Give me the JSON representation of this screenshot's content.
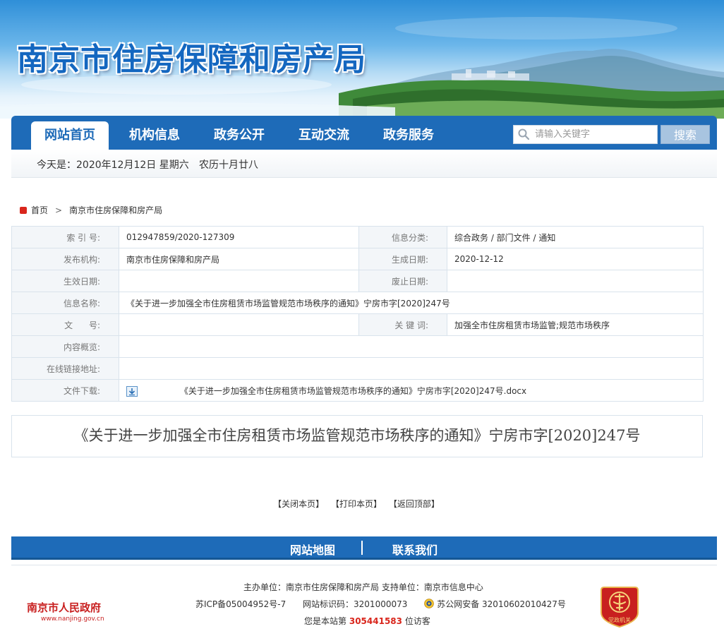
{
  "header": {
    "site_title": "南京市住房保障和房产局"
  },
  "nav": {
    "items": [
      {
        "label": "网站首页",
        "active": true
      },
      {
        "label": "机构信息",
        "active": false
      },
      {
        "label": "政务公开",
        "active": false
      },
      {
        "label": "互动交流",
        "active": false
      },
      {
        "label": "政务服务",
        "active": false
      }
    ],
    "search": {
      "placeholder": "请输入关键字",
      "button_label": "搜索"
    }
  },
  "datebar": {
    "today": "今天是：2020年12月12日  星期六",
    "lunar": "农历十月廿八"
  },
  "breadcrumb": {
    "home": "首页",
    "separator": ">",
    "current": "南京市住房保障和房产局"
  },
  "info": {
    "index_label": "索 引 号:",
    "index_value": "012947859/2020-127309",
    "category_label": "信息分类:",
    "category_value": "综合政务 / 部门文件 / 通知",
    "publisher_label": "发布机构:",
    "publisher_value": "南京市住房保障和房产局",
    "created_label": "生成日期:",
    "created_value": "2020-12-12",
    "effective_label": "生效日期:",
    "effective_value": "",
    "abolish_label": "废止日期:",
    "abolish_value": "",
    "name_label": "信息名称:",
    "name_value": "《关于进一步加强全市住房租赁市场监管规范市场秩序的通知》宁房市字[2020]247号",
    "docno_label": "文      号:",
    "docno_value": "",
    "keywords_label": "关 键 词:",
    "keywords_value": "加强全市住房租赁市场监管;规范市场秩序",
    "summary_label": "内容概览:",
    "summary_value": "",
    "link_label": "在线链接地址:",
    "link_value": "",
    "download_label": "文件下载:",
    "download_file": "《关于进一步加强全市住房租赁市场监管规范市场秩序的通知》宁房市字[2020]247号.docx"
  },
  "article": {
    "title": "《关于进一步加强全市住房租赁市场监管规范市场秩序的通知》宁房市字[2020]247号"
  },
  "actions": {
    "close": "【关闭本页】",
    "print": "【打印本页】",
    "top": "【返回顶部】"
  },
  "footer": {
    "nav": [
      "网站地图",
      "联系我们"
    ],
    "sponsor": "主办单位：南京市住房保障和房产局 支持单位：南京市信息中心",
    "icp": "苏ICP备05004952号-7",
    "site_code": "网站标识码：3201000073",
    "police": "苏公网安备 32010602010427号",
    "visits_prefix": "您是本站第",
    "visits_count": "305441583",
    "visits_suffix": "位访客",
    "gov_logo_name": "南京市人民政府",
    "gov_logo_url": "www.nanjing.gov.cn",
    "party_badge_text": "党政机关"
  },
  "colors": {
    "nav_blue": "#1e6bb8",
    "title_blue": "#1467c0",
    "accent_red": "#d9261c"
  },
  "icons": [
    "search-icon",
    "home-icon",
    "download-icon",
    "police-badge-icon",
    "party-badge-icon"
  ]
}
